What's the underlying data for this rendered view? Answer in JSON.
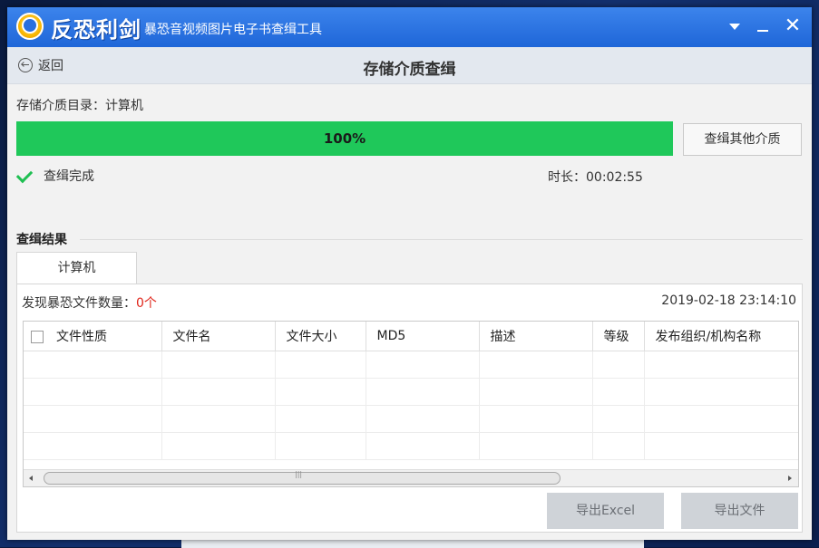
{
  "window": {
    "app_name": "反恐利剑",
    "app_subtitle": "暴恐音视频图片电子书查缉工具"
  },
  "nav": {
    "back_label": "返回",
    "page_title": "存储介质查缉"
  },
  "scan": {
    "media_dir_label": "存储介质目录：计算机",
    "progress_text": "100%",
    "progress_fraction": 1.0,
    "other_media_button": "查缉其他介质",
    "status_text": "查缉完成",
    "duration_text": "时长：00:02:55"
  },
  "results": {
    "section_title": "查缉结果",
    "tab_label": "计算机",
    "count_label": "发现暴恐文件数量：",
    "count_value": "0个",
    "timestamp": "2019-02-18 23:14:10",
    "columns": [
      "文件性质",
      "文件名",
      "文件大小",
      "MD5",
      "描述",
      "等级",
      "发布组织/机构名称"
    ],
    "rows": []
  },
  "actions": {
    "export_excel": "导出Excel",
    "export_file": "导出文件"
  },
  "colors": {
    "titlebar": "#2f7ae5",
    "progress": "#22cc5c",
    "count_value": "#e0261b",
    "check": "#1fbf52"
  }
}
